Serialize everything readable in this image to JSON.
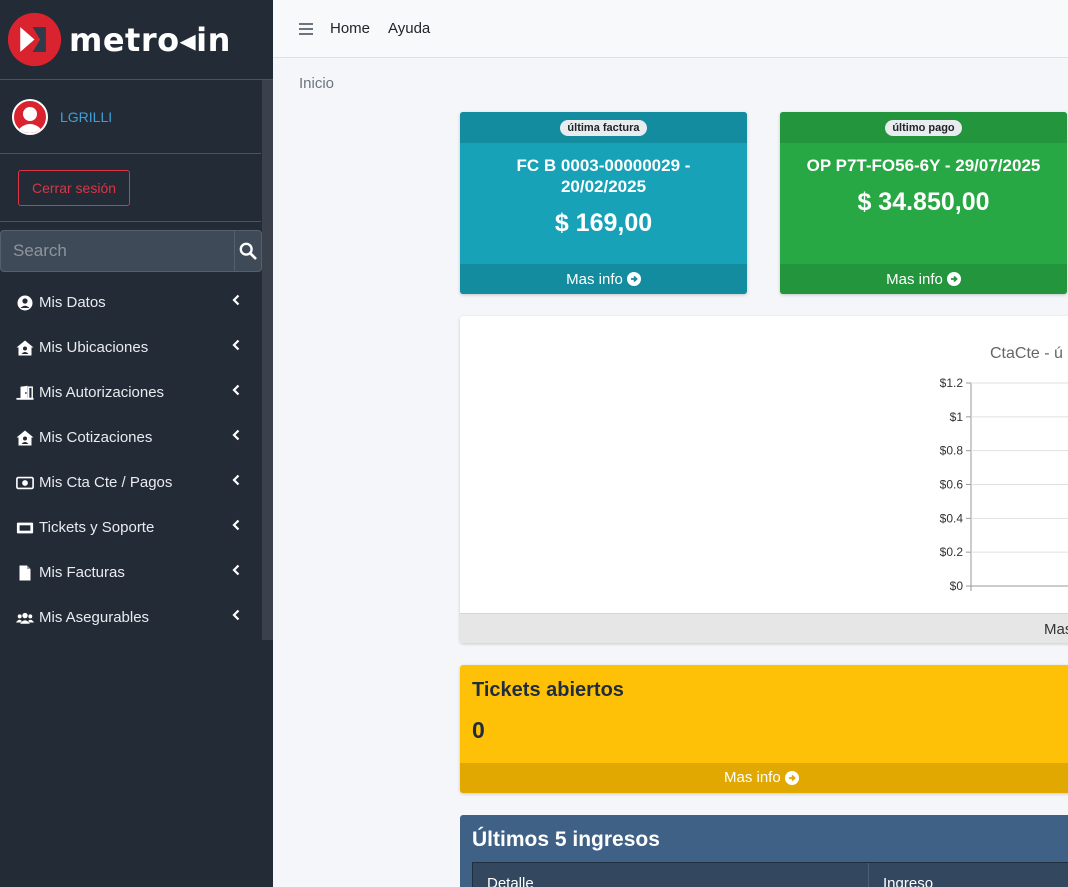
{
  "brand": {
    "name": "metro◂in",
    "accent": "#d9232e"
  },
  "user": {
    "name": "LGRILLI",
    "logout_label": "Cerrar sesión"
  },
  "search": {
    "placeholder": "Search"
  },
  "sidebar": {
    "items": [
      {
        "label": "Mis Datos",
        "icon": "user-circle-icon"
      },
      {
        "label": "Mis Ubicaciones",
        "icon": "house-user-icon"
      },
      {
        "label": "Mis Autorizaciones",
        "icon": "door-open-icon"
      },
      {
        "label": "Mis Cotizaciones",
        "icon": "house-user-icon"
      },
      {
        "label": "Mis Cta Cte / Pagos",
        "icon": "money-bill-icon"
      },
      {
        "label": "Tickets y Soporte",
        "icon": "ticket-icon"
      },
      {
        "label": "Mis Facturas",
        "icon": "file-icon"
      },
      {
        "label": "Mis Asegurables",
        "icon": "users-icon"
      }
    ]
  },
  "topbar": {
    "home_label": "Home",
    "help_label": "Ayuda"
  },
  "breadcrumb": "Inicio",
  "last_invoice": {
    "badge": "última factura",
    "title": "FC B 0003-00000029 - 20/02/2025",
    "amount": "$ 169,00",
    "more": "Mas info",
    "color": "#17a2b8"
  },
  "last_payment": {
    "badge": "último pago",
    "title": "OP P7T-FO56-6Y - 29/07/2025",
    "amount": "$ 34.850,00",
    "more": "Mas info",
    "color": "#28a745"
  },
  "chart_data": {
    "type": "line",
    "title": "CtaCte - ú",
    "yticks": [
      "$0",
      "$0.2",
      "$0.4",
      "$0.6",
      "$0.8",
      "$1",
      "$1.2"
    ],
    "ylim": [
      0,
      1.2
    ],
    "series": [],
    "footer": "Mas"
  },
  "tickets": {
    "title": "Tickets abiertos",
    "count": "0",
    "more": "Mas info",
    "color": "#ffc107"
  },
  "ingresos": {
    "title": "Últimos 5 ingresos",
    "columns": [
      "Detalle",
      "Ingreso"
    ]
  }
}
